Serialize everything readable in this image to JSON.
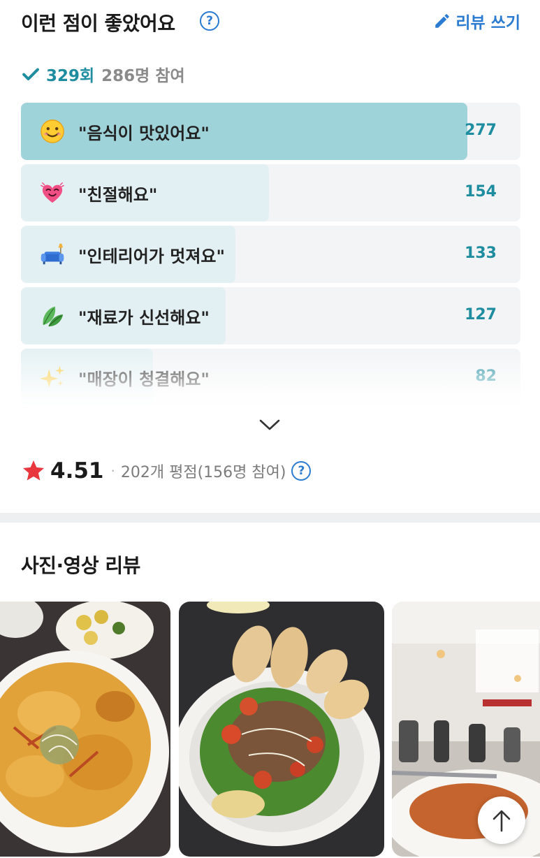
{
  "header": {
    "title": "이런 점이 좋았어요",
    "help": "?",
    "review_write_label": "리뷰 쓰기"
  },
  "stats": {
    "count": "329회",
    "participants": "286명 참여"
  },
  "keywords": [
    {
      "icon": "smiley-face-icon",
      "label": "\"음식이 맛있어요\"",
      "count": "277",
      "value": 277
    },
    {
      "icon": "heart-face-icon",
      "label": "\"친절해요\"",
      "count": "154",
      "value": 154
    },
    {
      "icon": "sofa-icon",
      "label": "\"인테리어가 멋져요\"",
      "count": "133",
      "value": 133
    },
    {
      "icon": "leaf-icon",
      "label": "\"재료가 신선해요\"",
      "count": "127",
      "value": 127
    },
    {
      "icon": "sparkles-icon",
      "label": "\"매장이 청결해요\"",
      "count": "82",
      "value": 82
    }
  ],
  "rating": {
    "value": "4.51",
    "separator": "·",
    "detail": "202개 평점(156명 참여)",
    "help": "?"
  },
  "photo_section": {
    "title": "사진·영상 리뷰"
  },
  "colors": {
    "accent_blue": "#2b7bd0",
    "accent_teal": "#1f8da0",
    "top_bar": "#9fd3da",
    "bar": "#e3f0f3",
    "star": "#e8383d"
  }
}
